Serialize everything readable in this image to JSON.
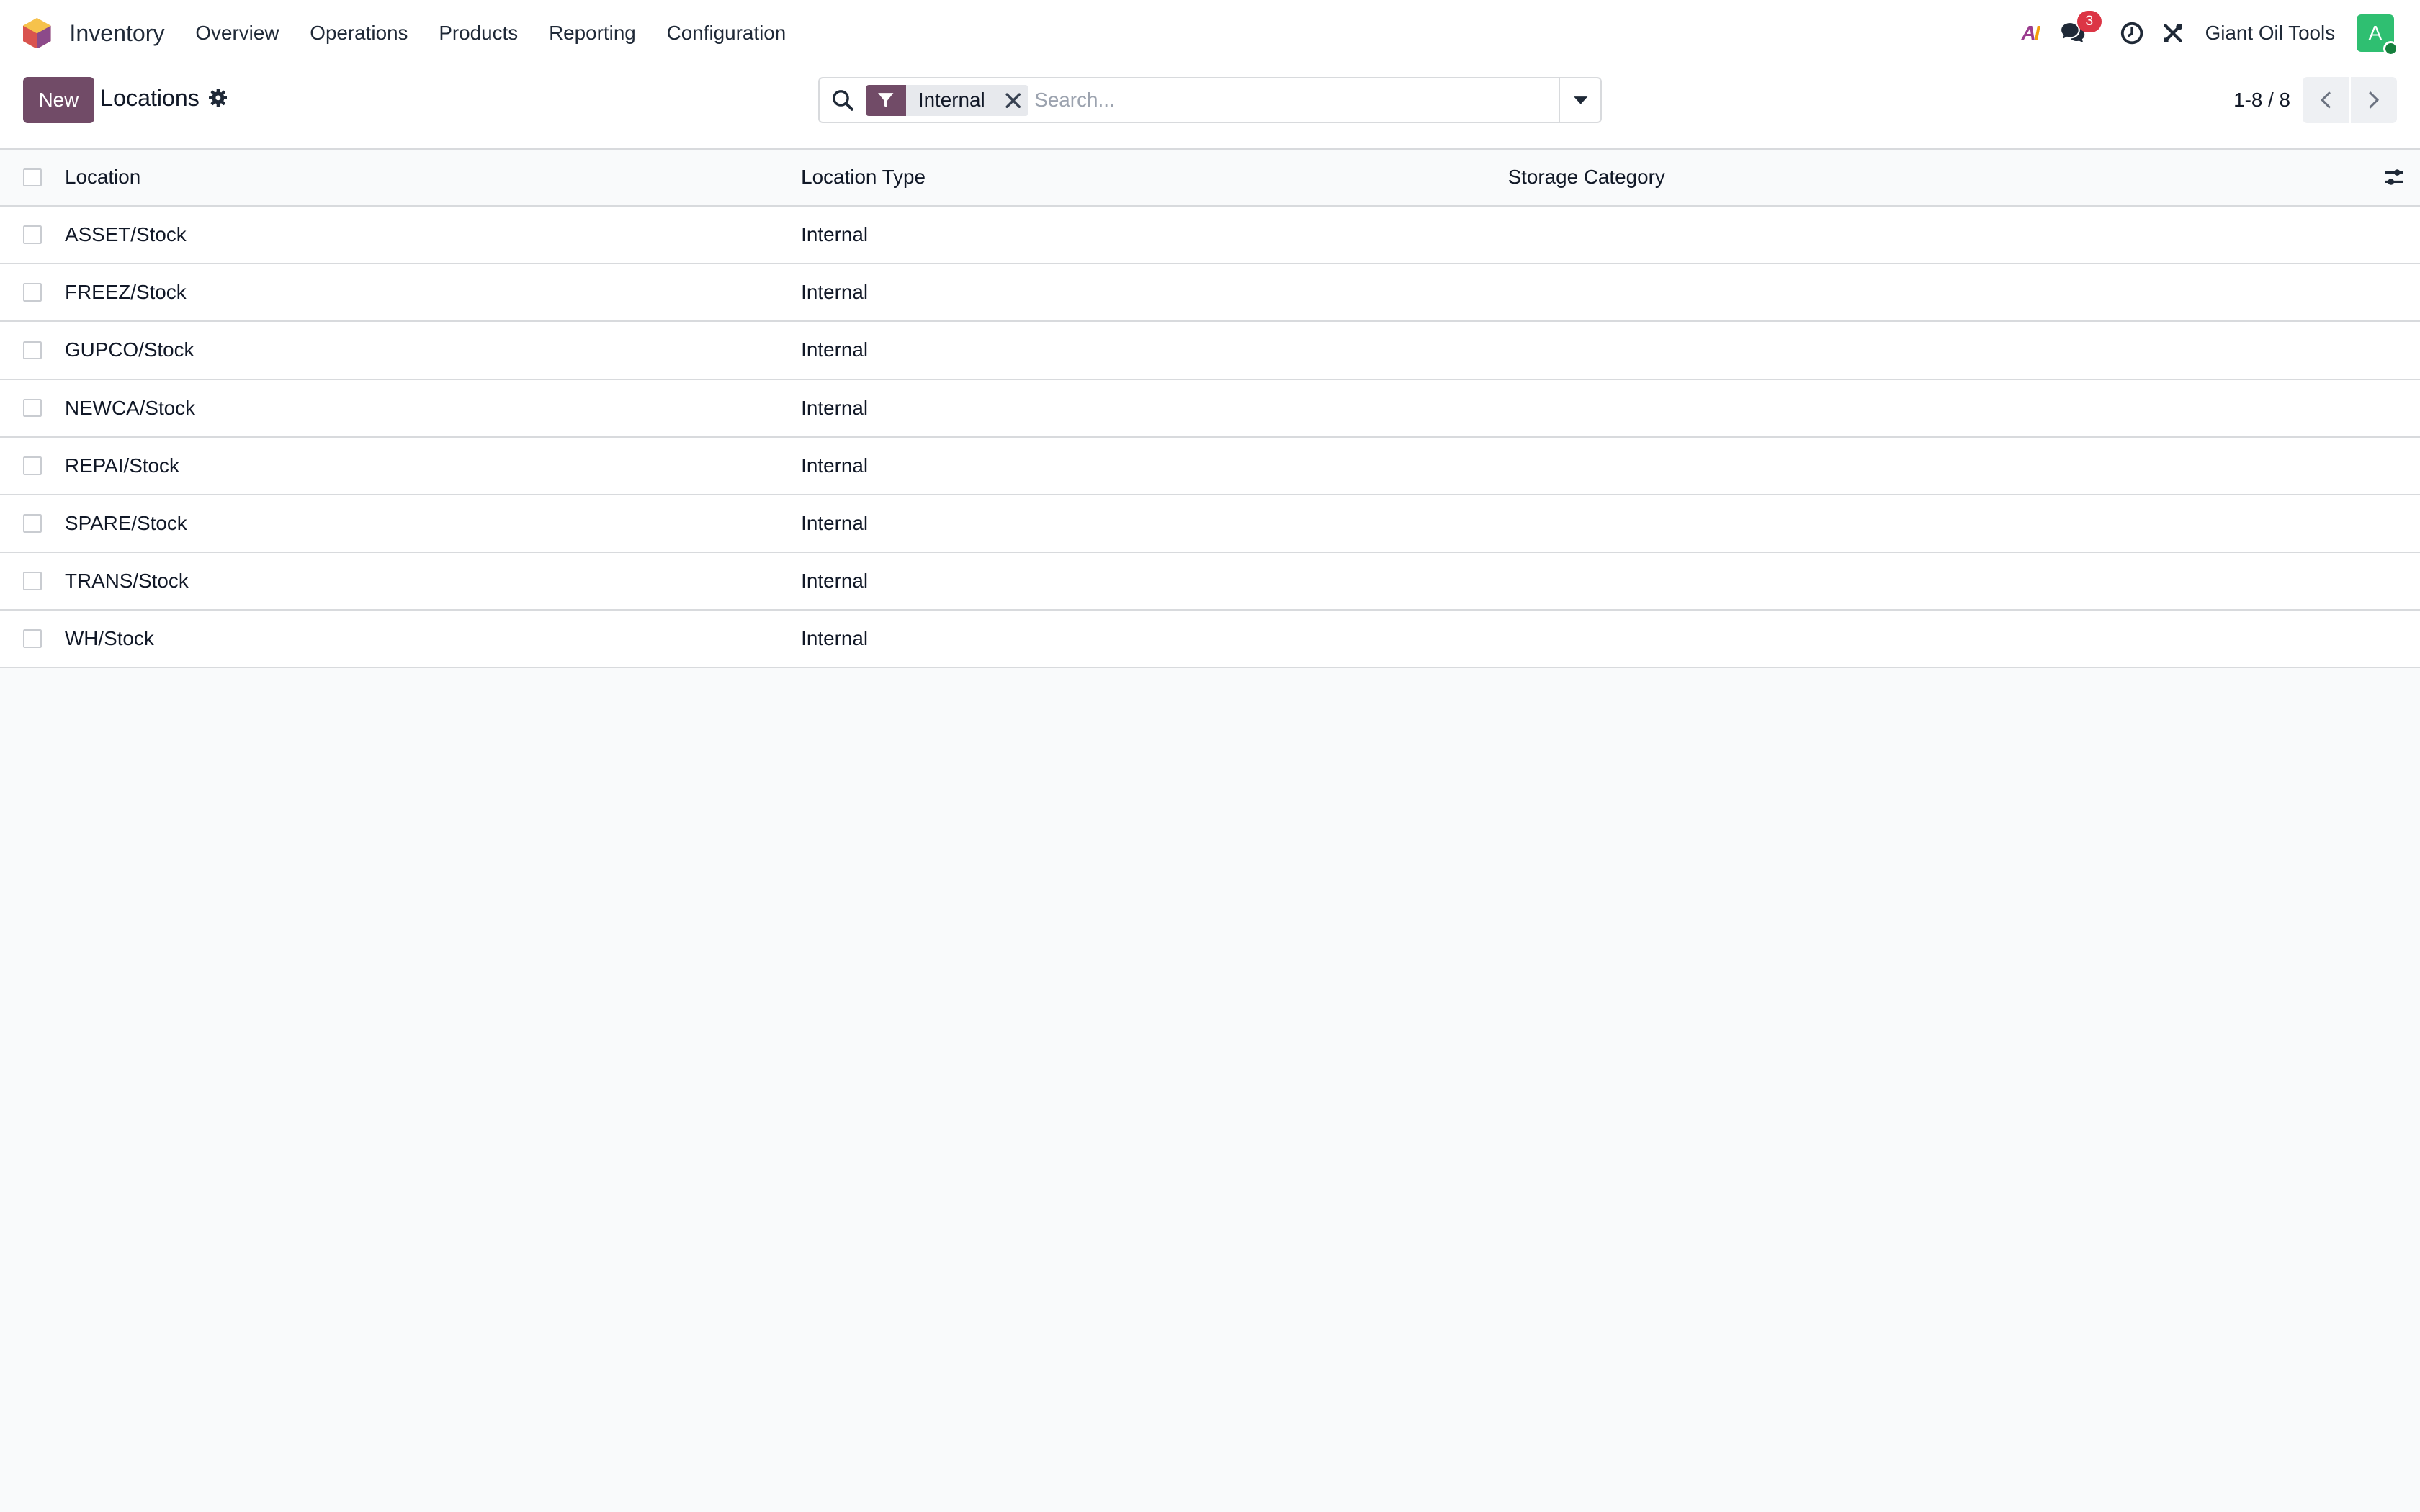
{
  "app": {
    "name": "Inventory",
    "logo_icon": "odoo-inventory-logo-icon"
  },
  "menu": [
    {
      "label": "Overview"
    },
    {
      "label": "Operations"
    },
    {
      "label": "Products"
    },
    {
      "label": "Reporting"
    },
    {
      "label": "Configuration"
    }
  ],
  "systray": {
    "ai_a": "A",
    "ai_i": "I",
    "messages_count": "3",
    "company": "Giant Oil Tools",
    "avatar_letter": "A"
  },
  "control": {
    "new_label": "New",
    "title": "Locations",
    "search_placeholder": "Search...",
    "facet_label": "Internal",
    "pager_value": "1-8 / 8"
  },
  "table": {
    "columns": [
      "Location",
      "Location Type",
      "Storage Category"
    ],
    "rows": [
      {
        "location": "ASSET/Stock",
        "type": "Internal",
        "category": ""
      },
      {
        "location": "FREEZ/Stock",
        "type": "Internal",
        "category": ""
      },
      {
        "location": "GUPCO/Stock",
        "type": "Internal",
        "category": ""
      },
      {
        "location": "NEWCA/Stock",
        "type": "Internal",
        "category": ""
      },
      {
        "location": "REPAI/Stock",
        "type": "Internal",
        "category": ""
      },
      {
        "location": "SPARE/Stock",
        "type": "Internal",
        "category": ""
      },
      {
        "location": "TRANS/Stock",
        "type": "Internal",
        "category": ""
      },
      {
        "location": "WH/Stock",
        "type": "Internal",
        "category": ""
      }
    ]
  },
  "colors": {
    "brand": "#714b67",
    "badge": "#dc3545",
    "avatar": "#2fbf71"
  }
}
